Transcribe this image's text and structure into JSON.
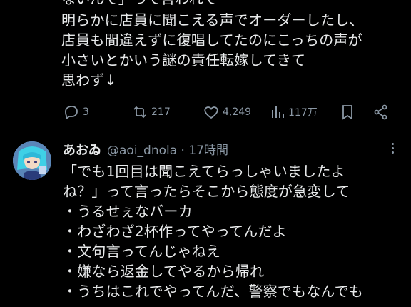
{
  "tweet1": {
    "lines": [
      "ないんで」って言われて",
      "明らかに店員に聞こえる声でオーダーしたし、",
      "店員も間違えずに復唱してたのにこっちの声が",
      "小さいとかいう謎の責任転嫁してきて",
      "思わず↓"
    ],
    "actions": {
      "replies": "3",
      "reposts": "217",
      "likes": "4,249",
      "views": "117万"
    }
  },
  "tweet2": {
    "display_name": "あおゐ",
    "handle_time": "@aoi_dnola · 17時間",
    "lines": [
      "「でも1回目は聞こえてらっしゃいましたよ",
      "ね？」って言ったらそこから態度が急変して",
      "・うるせぇなバーカ",
      "・わざわざ2杯作ってやってんだよ",
      "・文句言ってんじゃねえ",
      "・嫌なら返金してやるから帰れ",
      "・うちはこれでやってんだ、警察でもなんでも"
    ]
  },
  "colors": {
    "background": "#000000",
    "text": "#e7e9ea",
    "muted": "#8b98a5"
  }
}
